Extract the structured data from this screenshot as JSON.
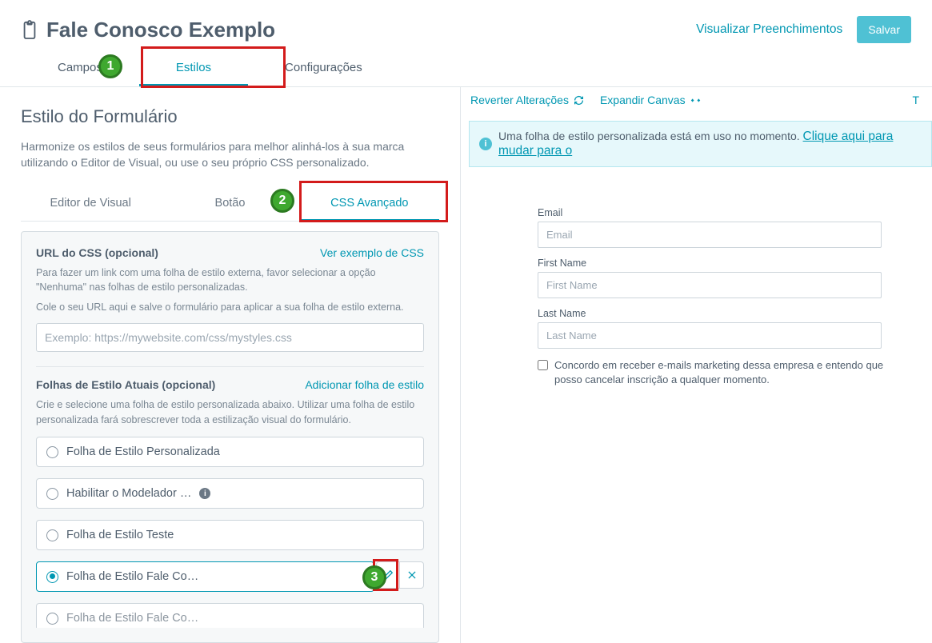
{
  "header": {
    "title": "Fale Conosco Exemplo",
    "visualizeLink": "Visualizar Preenchimentos",
    "saveBtn": "Salvar"
  },
  "tabs": {
    "campos": "Campos",
    "estilos": "Estilos",
    "config": "Configurações"
  },
  "badges": {
    "one": "1",
    "two": "2",
    "three": "3"
  },
  "style": {
    "title": "Estilo do Formulário",
    "desc": "Harmonize os estilos de seus formulários para melhor alinhá-los à sua marca utilizando o Editor de Visual, ou use o seu próprio CSS personalizado."
  },
  "subtabs": {
    "visual": "Editor de Visual",
    "botao": "Botão",
    "css": "CSS Avançado"
  },
  "cssPanel": {
    "urlLabel": "URL do CSS (opcional)",
    "exampleLink": "Ver exemplo de CSS",
    "help1": "Para fazer um link com uma folha de estilo externa, favor selecionar a opção \"Nenhuma\" nas folhas de estilo personalizadas.",
    "help2": "Cole o seu URL aqui e salve o formulário para aplicar a sua folha de estilo externa.",
    "urlPlaceholder": "Exemplo: https://mywebsite.com/css/mystyles.css",
    "sheetsLabel": "Folhas de Estilo Atuais (opcional)",
    "addLink": "Adicionar folha de estilo",
    "sheetsHelp": "Crie e selecione uma folha de estilo personalizada abaixo. Utilizar uma folha de estilo personalizada fará sobrescrever toda a estilização visual do formulário.",
    "rows": [
      {
        "label": "Folha de Estilo Personalizada",
        "info": false
      },
      {
        "label": "Habilitar o Modelador …",
        "info": true
      },
      {
        "label": "Folha de Estilo Teste",
        "info": false
      },
      {
        "label": "Folha de Estilo Fale Co…",
        "info": false,
        "selected": true,
        "actions": true
      },
      {
        "label": "Folha de Estilo Fale Co…",
        "info": false,
        "partial": true
      }
    ]
  },
  "preview": {
    "revert": "Reverter Alterações",
    "expand": "Expandir Canvas",
    "bannerText": "Uma folha de estilo personalizada está em uso no momento. ",
    "bannerLink": "Clique aqui para mudar para o",
    "fields": [
      {
        "label": "Email",
        "placeholder": "Email"
      },
      {
        "label": "First Name",
        "placeholder": "First Name"
      },
      {
        "label": "Last Name",
        "placeholder": "Last Name"
      }
    ],
    "consent": "Concordo em receber e-mails marketing dessa empresa e entendo que posso cancelar inscrição a qualquer momento."
  }
}
